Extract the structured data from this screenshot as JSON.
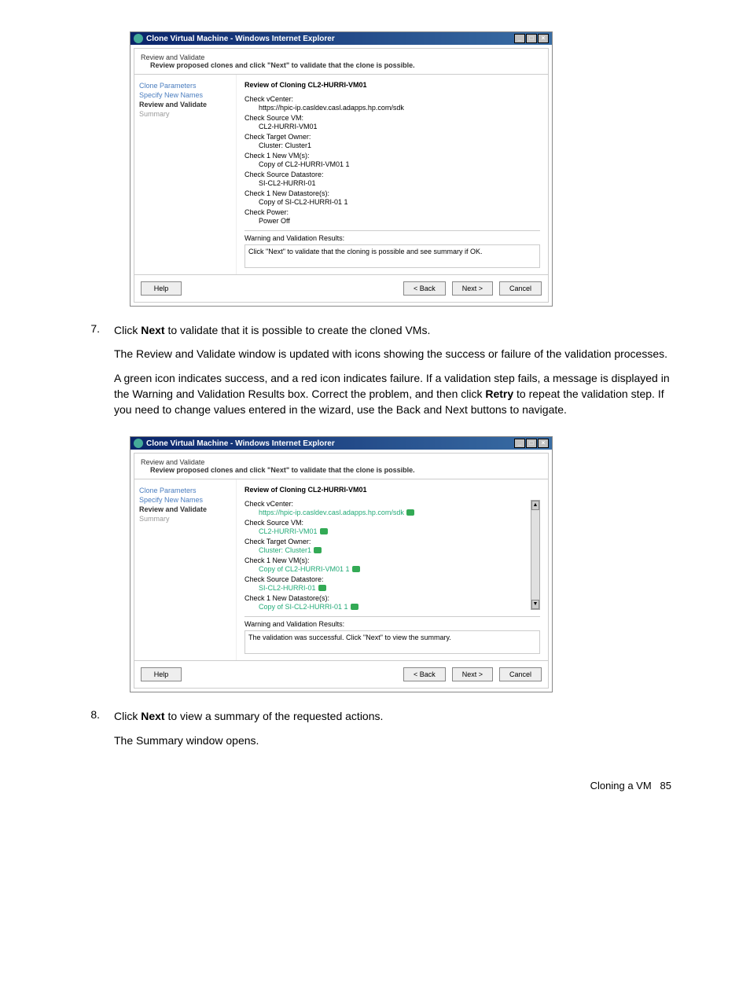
{
  "dialog1": {
    "titlebar": "Clone Virtual Machine - Windows Internet Explorer",
    "header_title": "Review and Validate",
    "header_sub": "Review proposed clones and click \"Next\" to validate that the clone is possible.",
    "sidebar": [
      "Clone Parameters",
      "Specify New Names",
      "Review and Validate",
      "Summary"
    ],
    "review_title": "Review of Cloning CL2-HURRI-VM01",
    "checks": [
      {
        "label": "Check vCenter:",
        "value": "https://hpic-ip.casldev.casl.adapps.hp.com/sdk"
      },
      {
        "label": "Check Source VM:",
        "value": "CL2-HURRI-VM01"
      },
      {
        "label": "Check Target Owner:",
        "value": "Cluster: Cluster1"
      },
      {
        "label": "Check 1 New VM(s):",
        "value": "Copy of CL2-HURRI-VM01 1"
      },
      {
        "label": "Check Source Datastore:",
        "value": "SI-CL2-HURRI-01"
      },
      {
        "label": "Check 1 New Datastore(s):",
        "value": "Copy of SI-CL2-HURRI-01 1"
      },
      {
        "label": "Check Power:",
        "value": "Power Off"
      }
    ],
    "warn_label": "Warning and Validation Results:",
    "warn_text": "Click \"Next\" to validate that the cloning is possible and see summary if OK.",
    "buttons": {
      "help": "Help",
      "back": "< Back",
      "next": "Next >",
      "cancel": "Cancel"
    }
  },
  "step7": {
    "num": "7.",
    "p1a": "Click ",
    "p1b": "Next",
    "p1c": " to validate that it is possible to create the cloned VMs.",
    "p2": "The Review and Validate window is updated with icons showing the success or failure of the validation processes.",
    "p3a": "A green icon indicates success, and a red icon indicates failure. If a validation step fails, a message is displayed in the Warning and Validation Results box. Correct the problem, and then click ",
    "p3b": "Retry",
    "p3c": " to repeat the validation step. If you need to change values entered in the wizard, use the Back and Next buttons to navigate."
  },
  "dialog2": {
    "titlebar": "Clone Virtual Machine - Windows Internet Explorer",
    "header_title": "Review and Validate",
    "header_sub": "Review proposed clones and click \"Next\" to validate that the clone is possible.",
    "sidebar": [
      "Clone Parameters",
      "Specify New Names",
      "Review and Validate",
      "Summary"
    ],
    "review_title": "Review of Cloning CL2-HURRI-VM01",
    "checks": [
      {
        "label": "Check vCenter:",
        "value": "https://hpic-ip.casldev.casl.adapps.hp.com/sdk"
      },
      {
        "label": "Check Source VM:",
        "value": "CL2-HURRI-VM01"
      },
      {
        "label": "Check Target Owner:",
        "value": "Cluster: Cluster1"
      },
      {
        "label": "Check 1 New VM(s):",
        "value": "Copy of CL2-HURRI-VM01 1"
      },
      {
        "label": "Check Source Datastore:",
        "value": "SI-CL2-HURRI-01"
      },
      {
        "label": "Check 1 New Datastore(s):",
        "value": "Copy of SI-CL2-HURRI-01 1"
      }
    ],
    "warn_label": "Warning and Validation Results:",
    "warn_text": "The validation was successful. Click \"Next\" to view the summary.",
    "buttons": {
      "help": "Help",
      "back": "< Back",
      "next": "Next >",
      "cancel": "Cancel"
    }
  },
  "step8": {
    "num": "8.",
    "p1a": "Click ",
    "p1b": "Next",
    "p1c": " to view a summary of the requested actions.",
    "p2": "The Summary window opens."
  },
  "footer": {
    "label": "Cloning a VM",
    "page": "85"
  }
}
